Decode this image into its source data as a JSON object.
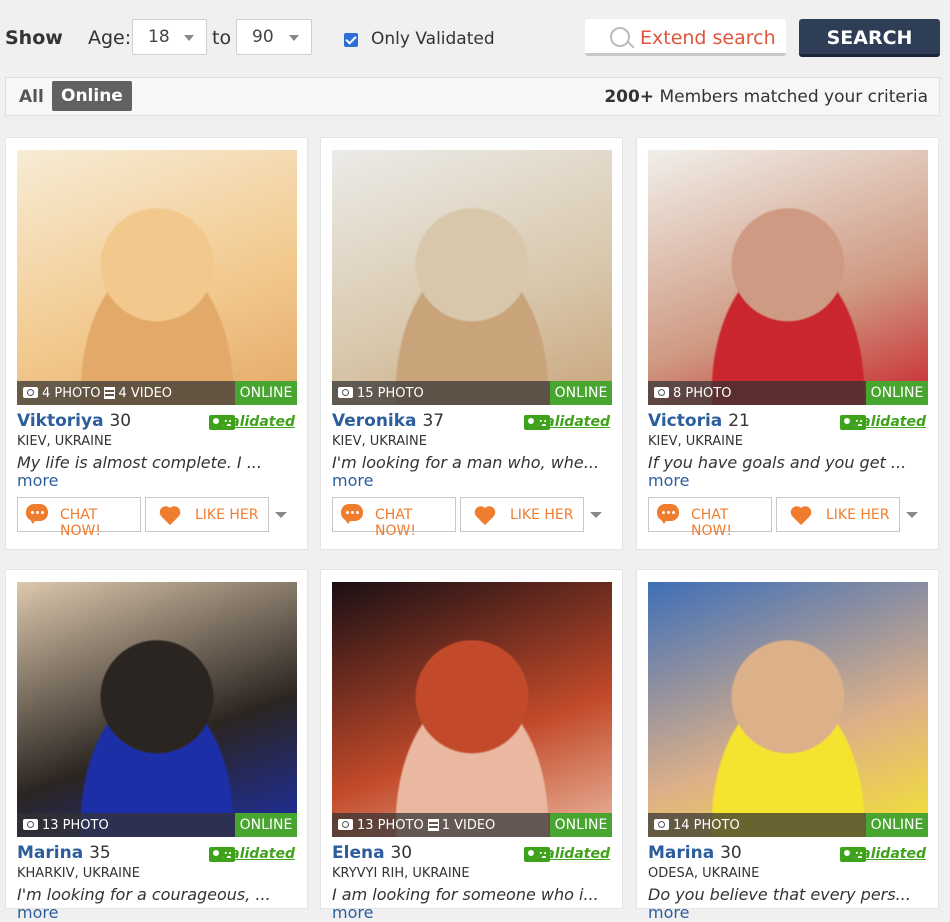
{
  "filter": {
    "show_label": "Show",
    "age_label": "Age:",
    "age_from": "18",
    "to_label": "to",
    "age_to": "90",
    "only_validated_label": "Only Validated",
    "only_validated_checked": true,
    "extend_search_label": "Extend search",
    "search_label": "SEARCH"
  },
  "tabs": {
    "all_label": "All",
    "online_label": "Online",
    "matched_count": "200+",
    "matched_text": "Members matched your criteria"
  },
  "card_labels": {
    "online": "ONLINE",
    "validated": "Validated",
    "chat": "CHAT NOW!",
    "like": "LIKE HER",
    "more": "more"
  },
  "profiles": [
    {
      "name": "Viktoriya",
      "age": "30",
      "photos": "4 PHOTO",
      "videos": "4 VIDEO",
      "location": "KIEV, UKRAINE",
      "description": "My life is almost complete. I ...",
      "photo_colors": [
        "#f7ecd5",
        "#f2c88c",
        "#e3a968"
      ]
    },
    {
      "name": "Veronika",
      "age": "37",
      "photos": "15 PHOTO",
      "videos": "",
      "location": "KIEV, UKRAINE",
      "description": "I'm looking for a man who, whe...",
      "photo_colors": [
        "#ecebe8",
        "#d8c7ab",
        "#c9a47b"
      ]
    },
    {
      "name": "Victoria",
      "age": "21",
      "photos": "8 PHOTO",
      "videos": "",
      "location": "KIEV, UKRAINE",
      "description": "If you have goals and you get ...",
      "photo_colors": [
        "#f1efea",
        "#cf9a83",
        "#c9272d"
      ]
    },
    {
      "name": "Marina",
      "age": "35",
      "photos": "13 PHOTO",
      "videos": "",
      "location": "KHARKIV, UKRAINE",
      "description": "I'm looking for a courageous, ...",
      "photo_colors": [
        "#dcc8ad",
        "#2b2521",
        "#1d2fa6"
      ]
    },
    {
      "name": "Elena",
      "age": "30",
      "photos": "13 PHOTO",
      "videos": "1 VIDEO",
      "location": "KRYVYI RIH, UKRAINE",
      "description": "I am looking for someone who i...",
      "photo_colors": [
        "#1a0f14",
        "#c24a2a",
        "#eab8a0"
      ]
    },
    {
      "name": "Marina",
      "age": "30",
      "photos": "14 PHOTO",
      "videos": "",
      "location": "ODESA, UKRAINE",
      "description": "Do you believe that every pers...",
      "photo_colors": [
        "#3e6fb8",
        "#dcb089",
        "#f6e330"
      ]
    }
  ]
}
